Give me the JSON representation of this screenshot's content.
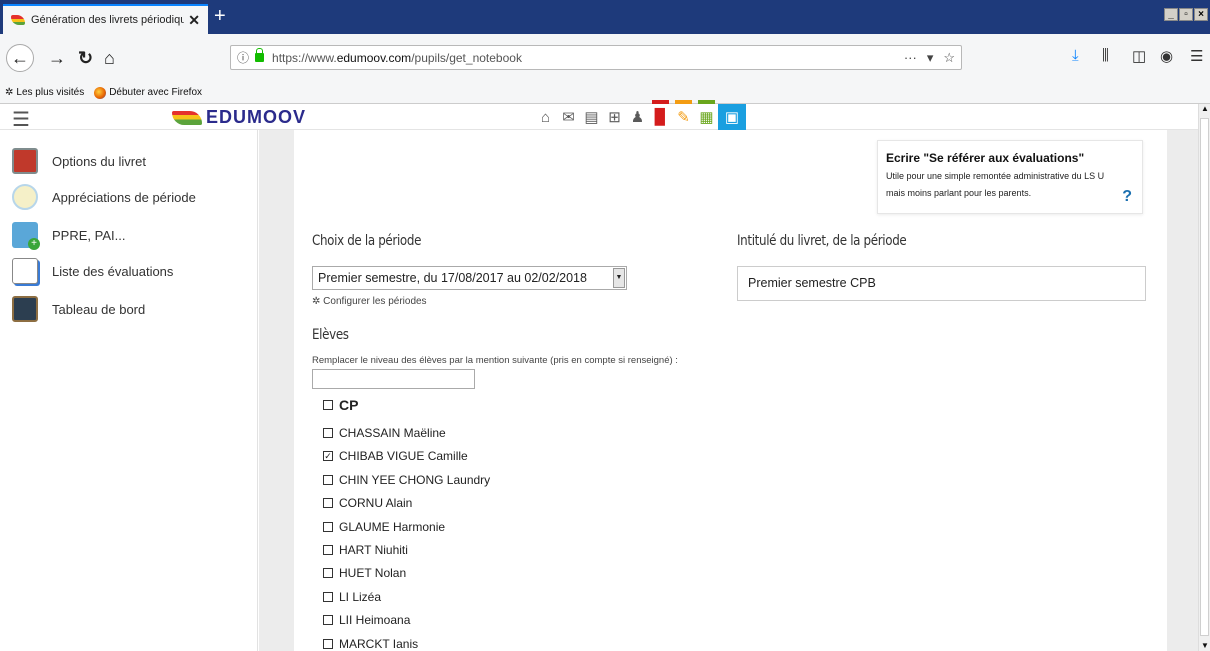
{
  "browser": {
    "tab_title": "Génération des livrets périodiques",
    "close_glyph": "✕",
    "newtab_glyph": "+",
    "url_prefix": "https://www.",
    "url_domain": "edumoov.com",
    "url_path": "/pupils/get_notebook",
    "bookmarks": [
      "Les plus visités",
      "Débuter avec Firefox"
    ],
    "window_buttons": [
      "_",
      "▫",
      "×"
    ]
  },
  "app": {
    "logo_text": "EDUMOOV",
    "toolbar_icons": [
      "home-icon",
      "mail-icon",
      "notebook-icon",
      "cart-icon",
      "user-icon",
      "document-icon",
      "pencil-icon",
      "calendar-icon",
      "briefcase-icon"
    ],
    "active_tool": "briefcase-icon"
  },
  "sidebar": {
    "items": [
      {
        "label": "Options du livret",
        "icon": "booklet-options-icon"
      },
      {
        "label": "Appréciations de période",
        "icon": "speech-bubble-icon"
      },
      {
        "label": "PPRE, PAI...",
        "icon": "box-plus-icon"
      },
      {
        "label": "Liste des évaluations",
        "icon": "list-icon"
      },
      {
        "label": "Tableau de bord",
        "icon": "dashboard-icon"
      }
    ]
  },
  "main": {
    "note_title": "Ecrire \"Se référer aux évaluations\"",
    "note_text": "Utile pour une simple remontée administrative du LS U mais moins parlant pour les parents.",
    "note_help": "?",
    "period_heading": "Choix de la période",
    "period_value": "Premier semestre, du 17/08/2017 au 02/02/2018",
    "configure_link": "Configurer les périodes",
    "title_heading": "Intitulé du livret, de la période",
    "title_value": "Premier semestre CPB",
    "students_heading": "Elèves",
    "replace_label": "Remplacer le niveau des élèves par la mention suivante (pris en compte si renseigné) :",
    "replace_value": "",
    "group_label": "CP",
    "students": [
      {
        "name": "CHASSAIN Maëline",
        "checked": false
      },
      {
        "name": "CHIBAB VIGUE Camille",
        "checked": true
      },
      {
        "name": "CHIN YEE CHONG Laundry",
        "checked": false
      },
      {
        "name": "CORNU Alain",
        "checked": false
      },
      {
        "name": "GLAUME Harmonie",
        "checked": false
      },
      {
        "name": "HART Niuhiti",
        "checked": false
      },
      {
        "name": "HUET Nolan",
        "checked": false
      },
      {
        "name": "LI Lizéa",
        "checked": false
      },
      {
        "name": "LII Heimoana",
        "checked": false
      },
      {
        "name": "MARCKT Ianis",
        "checked": false
      }
    ]
  }
}
